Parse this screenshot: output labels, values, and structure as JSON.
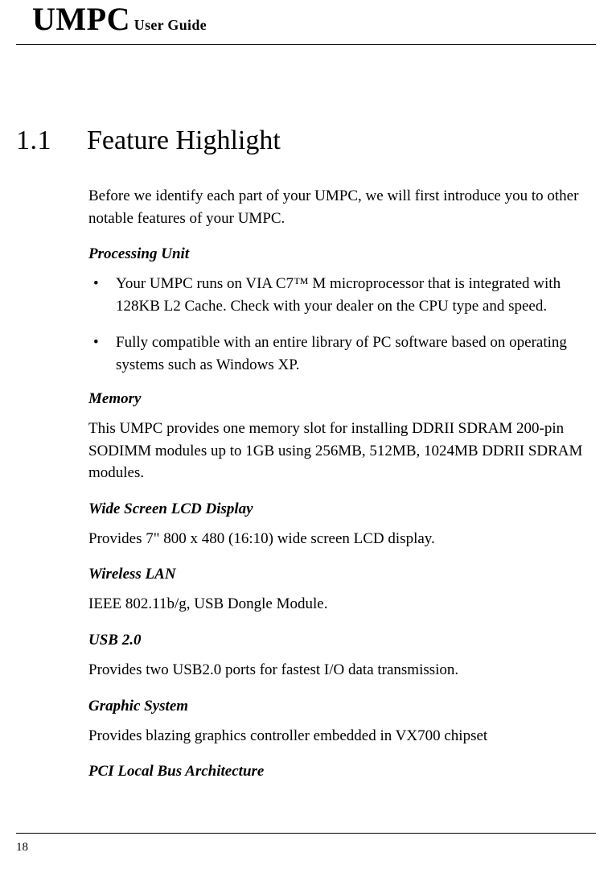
{
  "header": {
    "big": "UMPC",
    "small": " User Guide"
  },
  "section": {
    "number": "1.1",
    "title": "Feature Highlight"
  },
  "intro": "Before we identify each part of your UMPC, we will first introduce you to other notable features of your UMPC.",
  "processing": {
    "heading": "Processing Unit",
    "bullet1": "Your UMPC runs on VIA C7™ M microprocessor that is integrated with 128KB L2 Cache. Check with your dealer on the CPU type and speed.",
    "bullet2": "Fully compatible with an entire library of PC software based on operating systems such as Windows XP."
  },
  "memory": {
    "heading": "Memory",
    "text": "This UMPC provides one memory slot for installing DDRII SDRAM 200-pin SODIMM modules up to 1GB using 256MB, 512MB, 1024MB DDRII SDRAM modules."
  },
  "display": {
    "heading": "Wide Screen LCD Display",
    "text": "Provides 7\" 800 x 480 (16:10) wide screen LCD display."
  },
  "wireless": {
    "heading": "Wireless LAN",
    "text": "IEEE 802.11b/g, USB Dongle Module."
  },
  "usb": {
    "heading": "USB 2.0",
    "text": "Provides two USB2.0 ports for fastest I/O data transmission."
  },
  "graphic": {
    "heading": "Graphic System",
    "text": "Provides blazing graphics controller embedded in VX700 chipset"
  },
  "pci": {
    "heading": "PCI Local Bus Architecture"
  },
  "page_number": "18"
}
